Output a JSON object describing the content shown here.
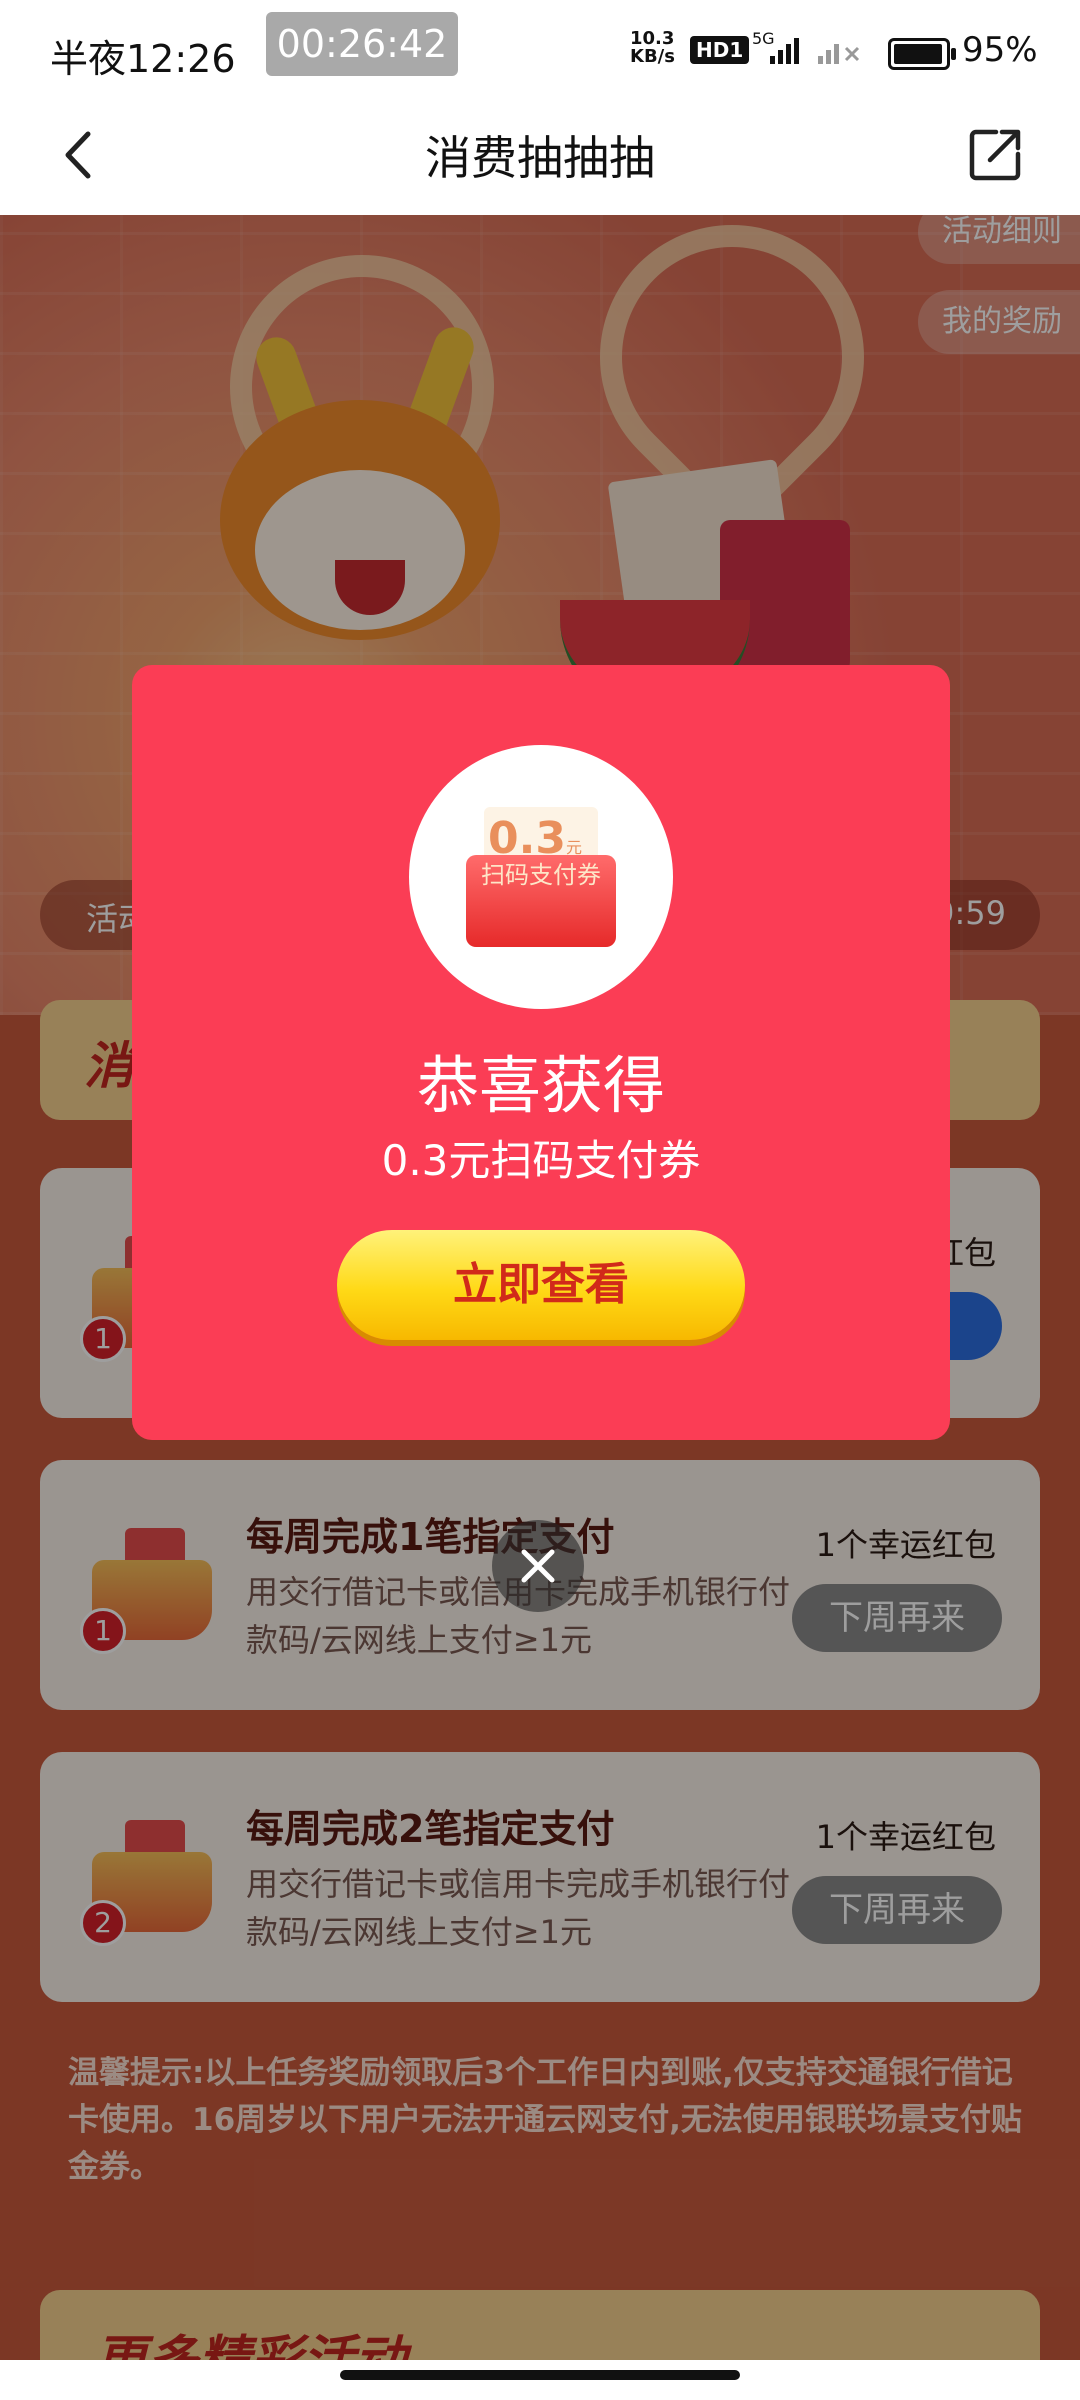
{
  "status_bar": {
    "time": "半夜12:26",
    "recording": "00:26:42",
    "net_speed_value": "10.3",
    "net_speed_unit": "KB/s",
    "hd": "HD1",
    "network": "5G",
    "battery": "95%",
    "battery_level": 0.95
  },
  "nav": {
    "title": "消费抽抽抽"
  },
  "side_buttons": {
    "rules": "活动细则",
    "my_rewards": "我的奖励"
  },
  "activity_bar": {
    "label": "活动",
    "countdown": "9:59"
  },
  "section_banner": {
    "text": "消"
  },
  "cards": [
    {
      "badge": "1",
      "title": "",
      "description": "",
      "reward": "红包",
      "button": ""
    },
    {
      "badge": "1",
      "title": "每周完成1笔指定支付",
      "description": "用交行借记卡或信用卡完成手机银行付款码/云网线上支付≥1元",
      "reward": "1个幸运红包",
      "button": "下周再来"
    },
    {
      "badge": "2",
      "title": "每周完成2笔指定支付",
      "description": "用交行借记卡或信用卡完成手机银行付款码/云网线上支付≥1元",
      "reward": "1个幸运红包",
      "button": "下周再来"
    }
  ],
  "tip": "温馨提示:以上任务奖励领取后3个工作日内到账,仅支持交通银行借记卡使用。16周岁以下用户无法开通云网支付,无法使用银联场景支付贴金券。",
  "more_banner": "更多精彩活动",
  "modal": {
    "coupon_amount": "0.3",
    "coupon_unit": "元",
    "coupon_label": "扫码支付券",
    "heading": "恭喜获得",
    "subheading": "0.3元扫码支付券",
    "cta": "立即查看"
  },
  "colors": {
    "modal_bg": "#fb3d55",
    "cta_yellow": "#ffd916",
    "cta_text": "#d12a1a",
    "page_bg": "#c85a3d"
  }
}
